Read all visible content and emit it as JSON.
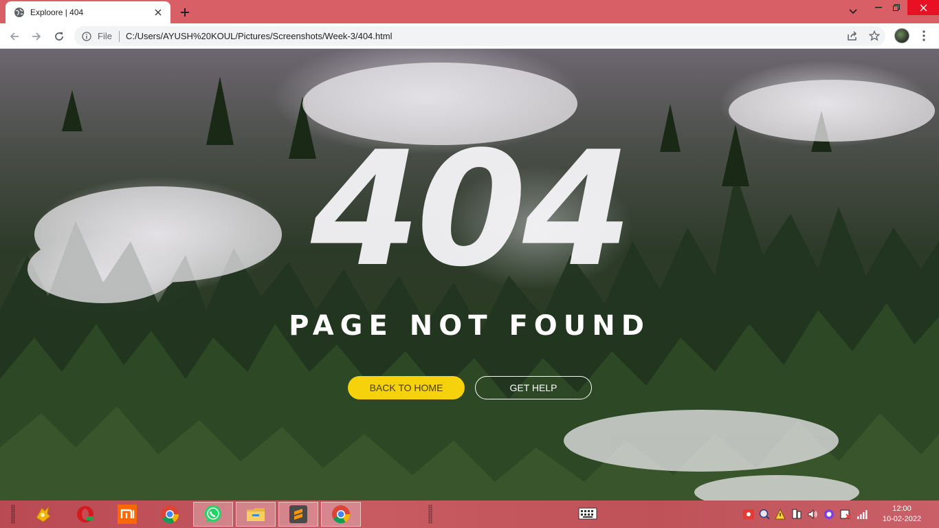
{
  "browser": {
    "tab_title": "Exploore | 404",
    "url_scheme": "File",
    "url": "C:/Users/AYUSH%20KOUL/Pictures/Screenshots/Week-3/404.html"
  },
  "page": {
    "error_code": "404",
    "message": "PAGE NOT FOUND",
    "buttons": {
      "home": "BACK TO HOME",
      "help": "GET HELP"
    },
    "colors": {
      "home_button": "#f6d20c",
      "help_border": "#ffffff"
    }
  },
  "taskbar": {
    "apps": [
      "pineapple-app",
      "opera-browser",
      "mi-app",
      "chrome",
      "whatsapp",
      "file-explorer",
      "sublime-text",
      "chrome-active"
    ],
    "clock": {
      "time": "12:00",
      "date": "10-02-2022"
    }
  }
}
